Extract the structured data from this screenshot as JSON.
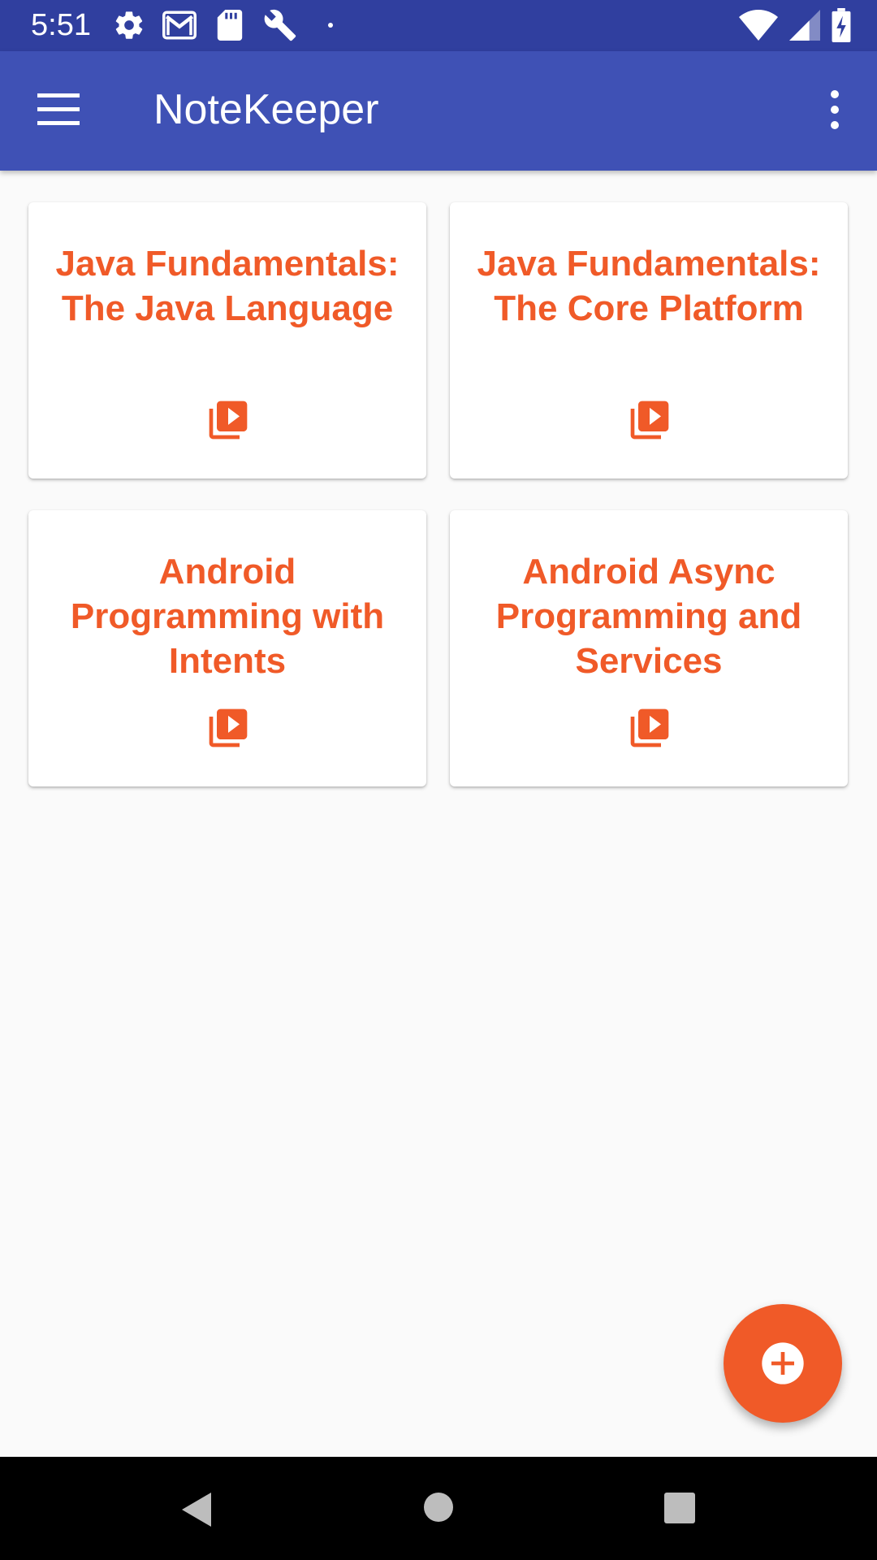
{
  "status_bar": {
    "time": "5:51",
    "left_icons": [
      "settings-icon",
      "gmail-icon",
      "sd-card-icon",
      "wrench-icon",
      "dot-icon"
    ],
    "right_icons": [
      "wifi-icon",
      "cell-signal-icon",
      "battery-charging-icon"
    ]
  },
  "app_bar": {
    "title": "NoteKeeper",
    "background": "#3f51b5",
    "status_background": "#303f9f"
  },
  "courses": [
    {
      "title": "Java Fundamentals: The Java Language",
      "icon": "video-library-icon"
    },
    {
      "title": "Java Fundamentals: The Core Platform",
      "icon": "video-library-icon"
    },
    {
      "title": "Android Programming with Intents",
      "icon": "video-library-icon"
    },
    {
      "title": "Android Async Programming and Services",
      "icon": "video-library-icon"
    }
  ],
  "accent_color": "#f05a28",
  "fab": {
    "icon": "add-circle-icon"
  },
  "nav_bar": {
    "buttons": [
      "back-icon",
      "home-icon",
      "recents-icon"
    ]
  }
}
